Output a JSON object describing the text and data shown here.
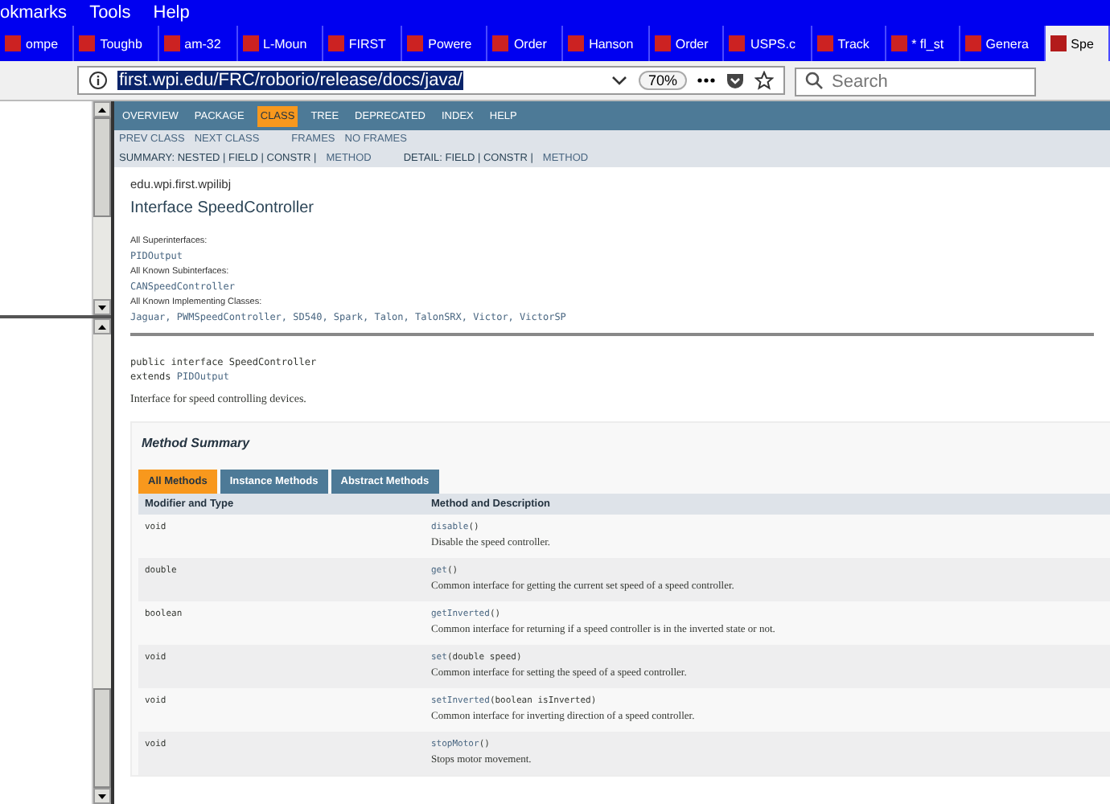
{
  "menu_bar": [
    "okmarks",
    "Tools",
    "Help"
  ],
  "tabs": [
    {
      "label": "ompe",
      "selected": false
    },
    {
      "label": "Toughb",
      "selected": false
    },
    {
      "label": "am-32",
      "selected": false
    },
    {
      "label": "L-Moun",
      "selected": false
    },
    {
      "label": "FIRST",
      "selected": false
    },
    {
      "label": "Powere",
      "selected": false
    },
    {
      "label": "Order",
      "selected": false
    },
    {
      "label": "Hanson",
      "selected": false
    },
    {
      "label": "Order",
      "selected": false
    },
    {
      "label": "USPS.c",
      "selected": false
    },
    {
      "label": "Track",
      "selected": false
    },
    {
      "label": "* fl_st",
      "selected": false
    },
    {
      "label": "Genera",
      "selected": false
    },
    {
      "label": "Spe",
      "selected": true
    }
  ],
  "address_bar": {
    "url": "first.wpi.edu/FRC/roborio/release/docs/java/",
    "zoom": "70%"
  },
  "search": {
    "placeholder": "Search"
  },
  "nav": {
    "items": [
      {
        "label": "OVERVIEW",
        "selected": false
      },
      {
        "label": "PACKAGE",
        "selected": false
      },
      {
        "label": "CLASS",
        "selected": true
      },
      {
        "label": "TREE",
        "selected": false
      },
      {
        "label": "DEPRECATED",
        "selected": false
      },
      {
        "label": "INDEX",
        "selected": false
      },
      {
        "label": "HELP",
        "selected": false
      }
    ],
    "sub_links": [
      "PREV CLASS",
      "NEXT CLASS",
      "FRAMES",
      "NO FRAMES"
    ],
    "summary": {
      "label": "SUMMARY: NESTED | FIELD | CONSTR |",
      "link": "METHOD"
    },
    "detail": {
      "label": "DETAIL: FIELD | CONSTR |",
      "link": "METHOD"
    }
  },
  "package": "edu.wpi.first.wpilibj",
  "title": "Interface SpeedController",
  "sections": [
    {
      "heading": "All Superinterfaces:",
      "value": "PIDOutput"
    },
    {
      "heading": "All Known Subinterfaces:",
      "value": "CANSpeedController"
    },
    {
      "heading": "All Known Implementing Classes:",
      "value": "Jaguar, PWMSpeedController, SD540, Spark, Talon, TalonSRX, Victor, VictorSP"
    }
  ],
  "declaration": {
    "line1": "public interface SpeedController",
    "keyword": "extends",
    "parent": "PIDOutput"
  },
  "description": "Interface for speed controlling devices.",
  "method_summary": {
    "title": "Method Summary",
    "tabs": [
      {
        "label": "All Methods",
        "selected": true
      },
      {
        "label": "Instance Methods",
        "selected": false
      },
      {
        "label": "Abstract Methods",
        "selected": false
      }
    ],
    "columns": [
      "Modifier and Type",
      "Method and Description"
    ],
    "rows": [
      {
        "type": "void",
        "name": "disable",
        "params": "()",
        "description": "Disable the speed controller."
      },
      {
        "type": "double",
        "name": "get",
        "params": "()",
        "description": "Common interface for getting the current set speed of a speed controller."
      },
      {
        "type": "boolean",
        "name": "getInverted",
        "params": "()",
        "description": "Common interface for returning if a speed controller is in the inverted state or not."
      },
      {
        "type": "void",
        "name": "set",
        "params": "(double speed)",
        "description": "Common interface for setting the speed of a speed controller."
      },
      {
        "type": "void",
        "name": "setInverted",
        "params": "(boolean isInverted)",
        "description": "Common interface for inverting direction of a speed controller."
      },
      {
        "type": "void",
        "name": "stopMotor",
        "params": "()",
        "description": "Stops motor movement."
      }
    ]
  }
}
